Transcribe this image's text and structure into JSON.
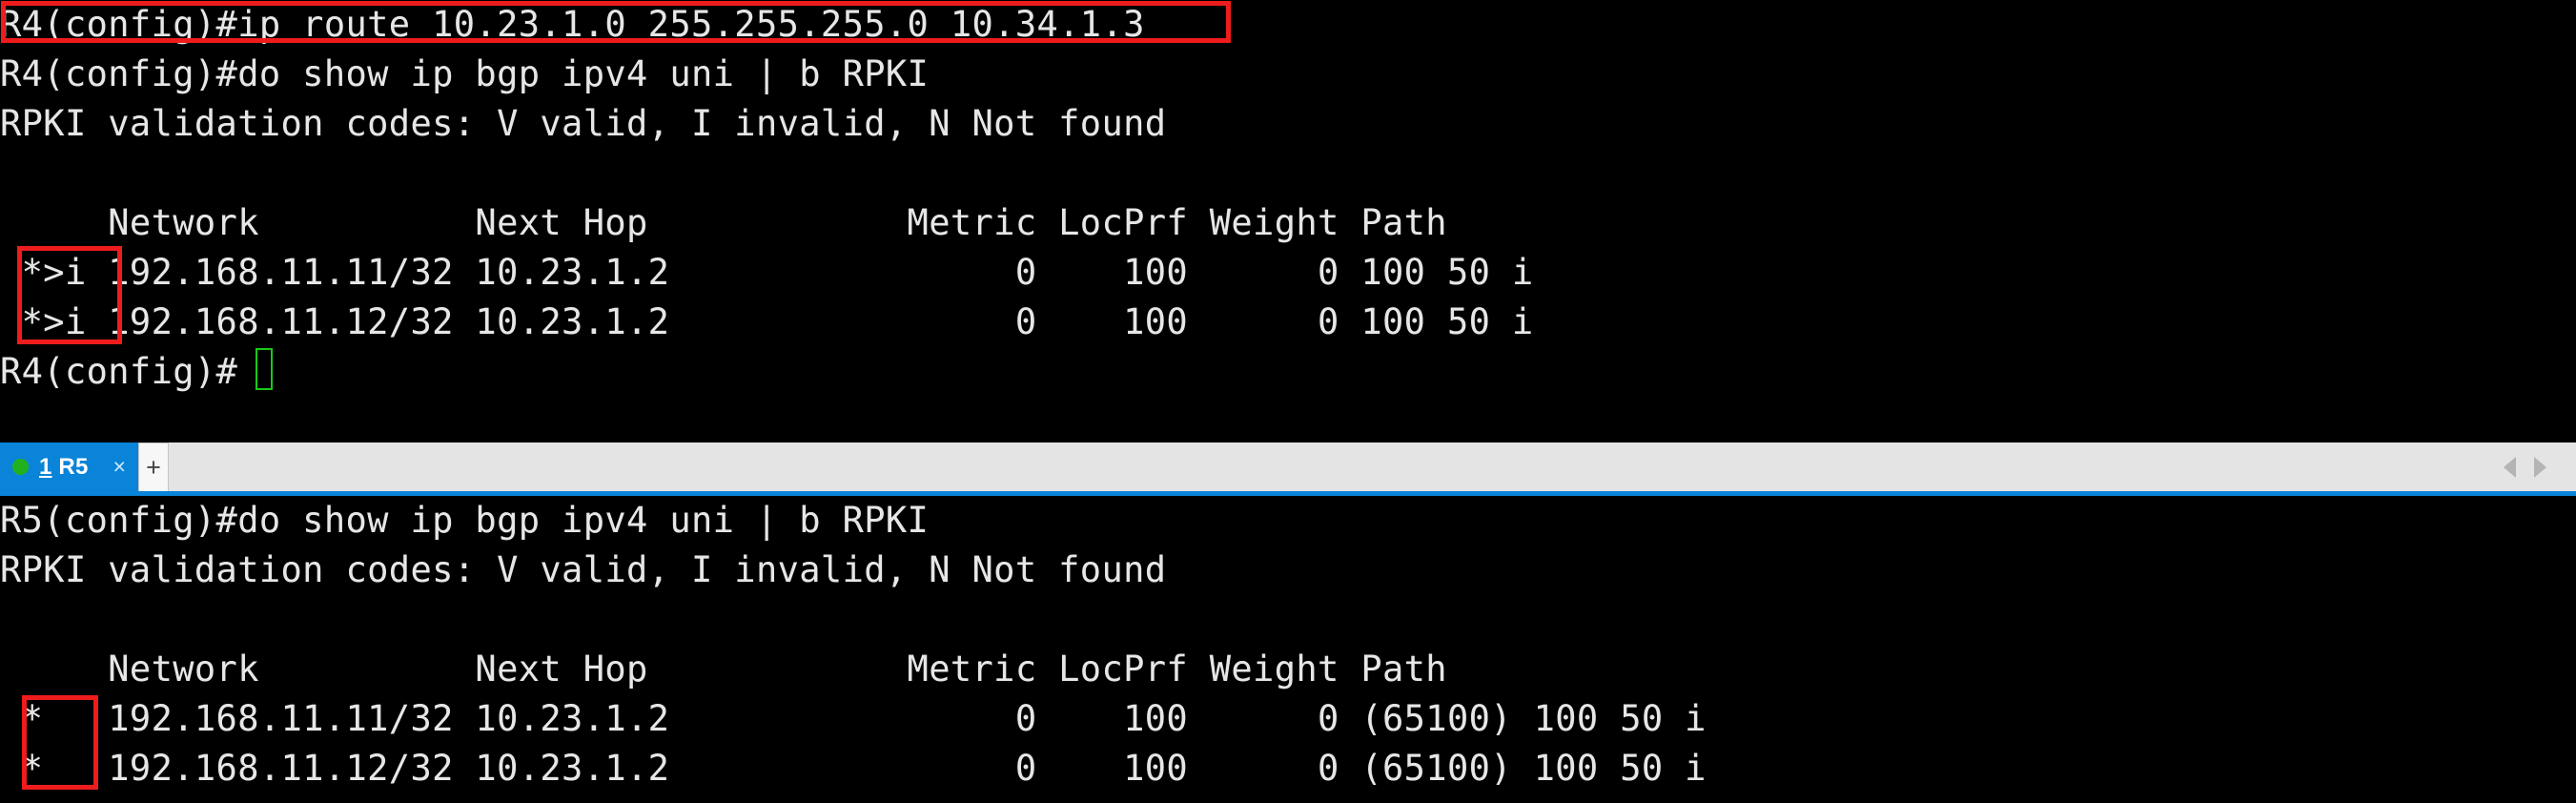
{
  "terminal_top": {
    "name": "R4",
    "lines": [
      "R4(config)#ip route 10.23.1.0 255.255.255.0 10.34.1.3",
      "R4(config)#do show ip bgp ipv4 uni | b RPKI",
      "RPKI validation codes: V valid, I invalid, N Not found",
      "",
      "     Network          Next Hop            Metric LocPrf Weight Path",
      " *>i 192.168.11.11/32 10.23.1.2                0    100      0 100 50 i",
      " *>i 192.168.11.12/32 10.23.1.2                0    100      0 100 50 i",
      "R4(config)#"
    ],
    "prompt": "R4(config)#",
    "command_entered": "ip route 10.23.1.0 255.255.255.0 10.34.1.3",
    "show_command": "do show ip bgp ipv4 uni | b RPKI",
    "rpki_legend": "RPKI validation codes: V valid, I invalid, N Not found",
    "table": {
      "headers": [
        "Network",
        "Next Hop",
        "Metric",
        "LocPrf",
        "Weight",
        "Path"
      ],
      "rows": [
        {
          "status": "*>i",
          "network": "192.168.11.11/32",
          "next_hop": "10.23.1.2",
          "metric": "0",
          "locprf": "100",
          "weight": "0",
          "path": "100 50 i"
        },
        {
          "status": "*>i",
          "network": "192.168.11.12/32",
          "next_hop": "10.23.1.2",
          "metric": "0",
          "locprf": "100",
          "weight": "0",
          "path": "100 50 i"
        }
      ]
    },
    "cursor_visible": true
  },
  "tabbar": {
    "tabs": [
      {
        "number": "1",
        "title": "R5",
        "label_num": "1",
        "label_text": " R5",
        "status_color": "#22b11e",
        "active": true,
        "close_glyph": "×"
      }
    ],
    "add_tab_glyph": "+",
    "scroll_left_name": "scroll-left",
    "scroll_right_name": "scroll-right",
    "active_color": "#0a84d8",
    "bar_color": "#e4e4e4"
  },
  "terminal_bottom": {
    "name": "R5",
    "lines": [
      "R5(config)#do show ip bgp ipv4 uni | b RPKI",
      "RPKI validation codes: V valid, I invalid, N Not found",
      "",
      "     Network          Next Hop            Metric LocPrf Weight Path",
      " *   192.168.11.11/32 10.23.1.2                0    100      0 (65100) 100 50 i",
      " *   192.168.11.12/32 10.23.1.2                0    100      0 (65100) 100 50 i"
    ],
    "prompt": "R5(config)#",
    "show_command": "do show ip bgp ipv4 uni | b RPKI",
    "rpki_legend": "RPKI validation codes: V valid, I invalid, N Not found",
    "table": {
      "headers": [
        "Network",
        "Next Hop",
        "Metric",
        "LocPrf",
        "Weight",
        "Path"
      ],
      "rows": [
        {
          "status": "*",
          "network": "192.168.11.11/32",
          "next_hop": "10.23.1.2",
          "metric": "0",
          "locprf": "100",
          "weight": "0",
          "path": "(65100) 100 50 i"
        },
        {
          "status": "*",
          "network": "192.168.11.12/32",
          "next_hop": "10.23.1.2",
          "metric": "0",
          "locprf": "100",
          "weight": "0",
          "path": "(65100) 100 50 i"
        }
      ]
    }
  },
  "annotations": {
    "box_color": "#ee1c1c",
    "cursor_color": "#19c819",
    "highlight_command": "R4(config)#ip route 10.23.1.0 255.255.255.0 10.34.1.3",
    "highlight_top_status": "*>i",
    "highlight_bottom_status": "*"
  }
}
